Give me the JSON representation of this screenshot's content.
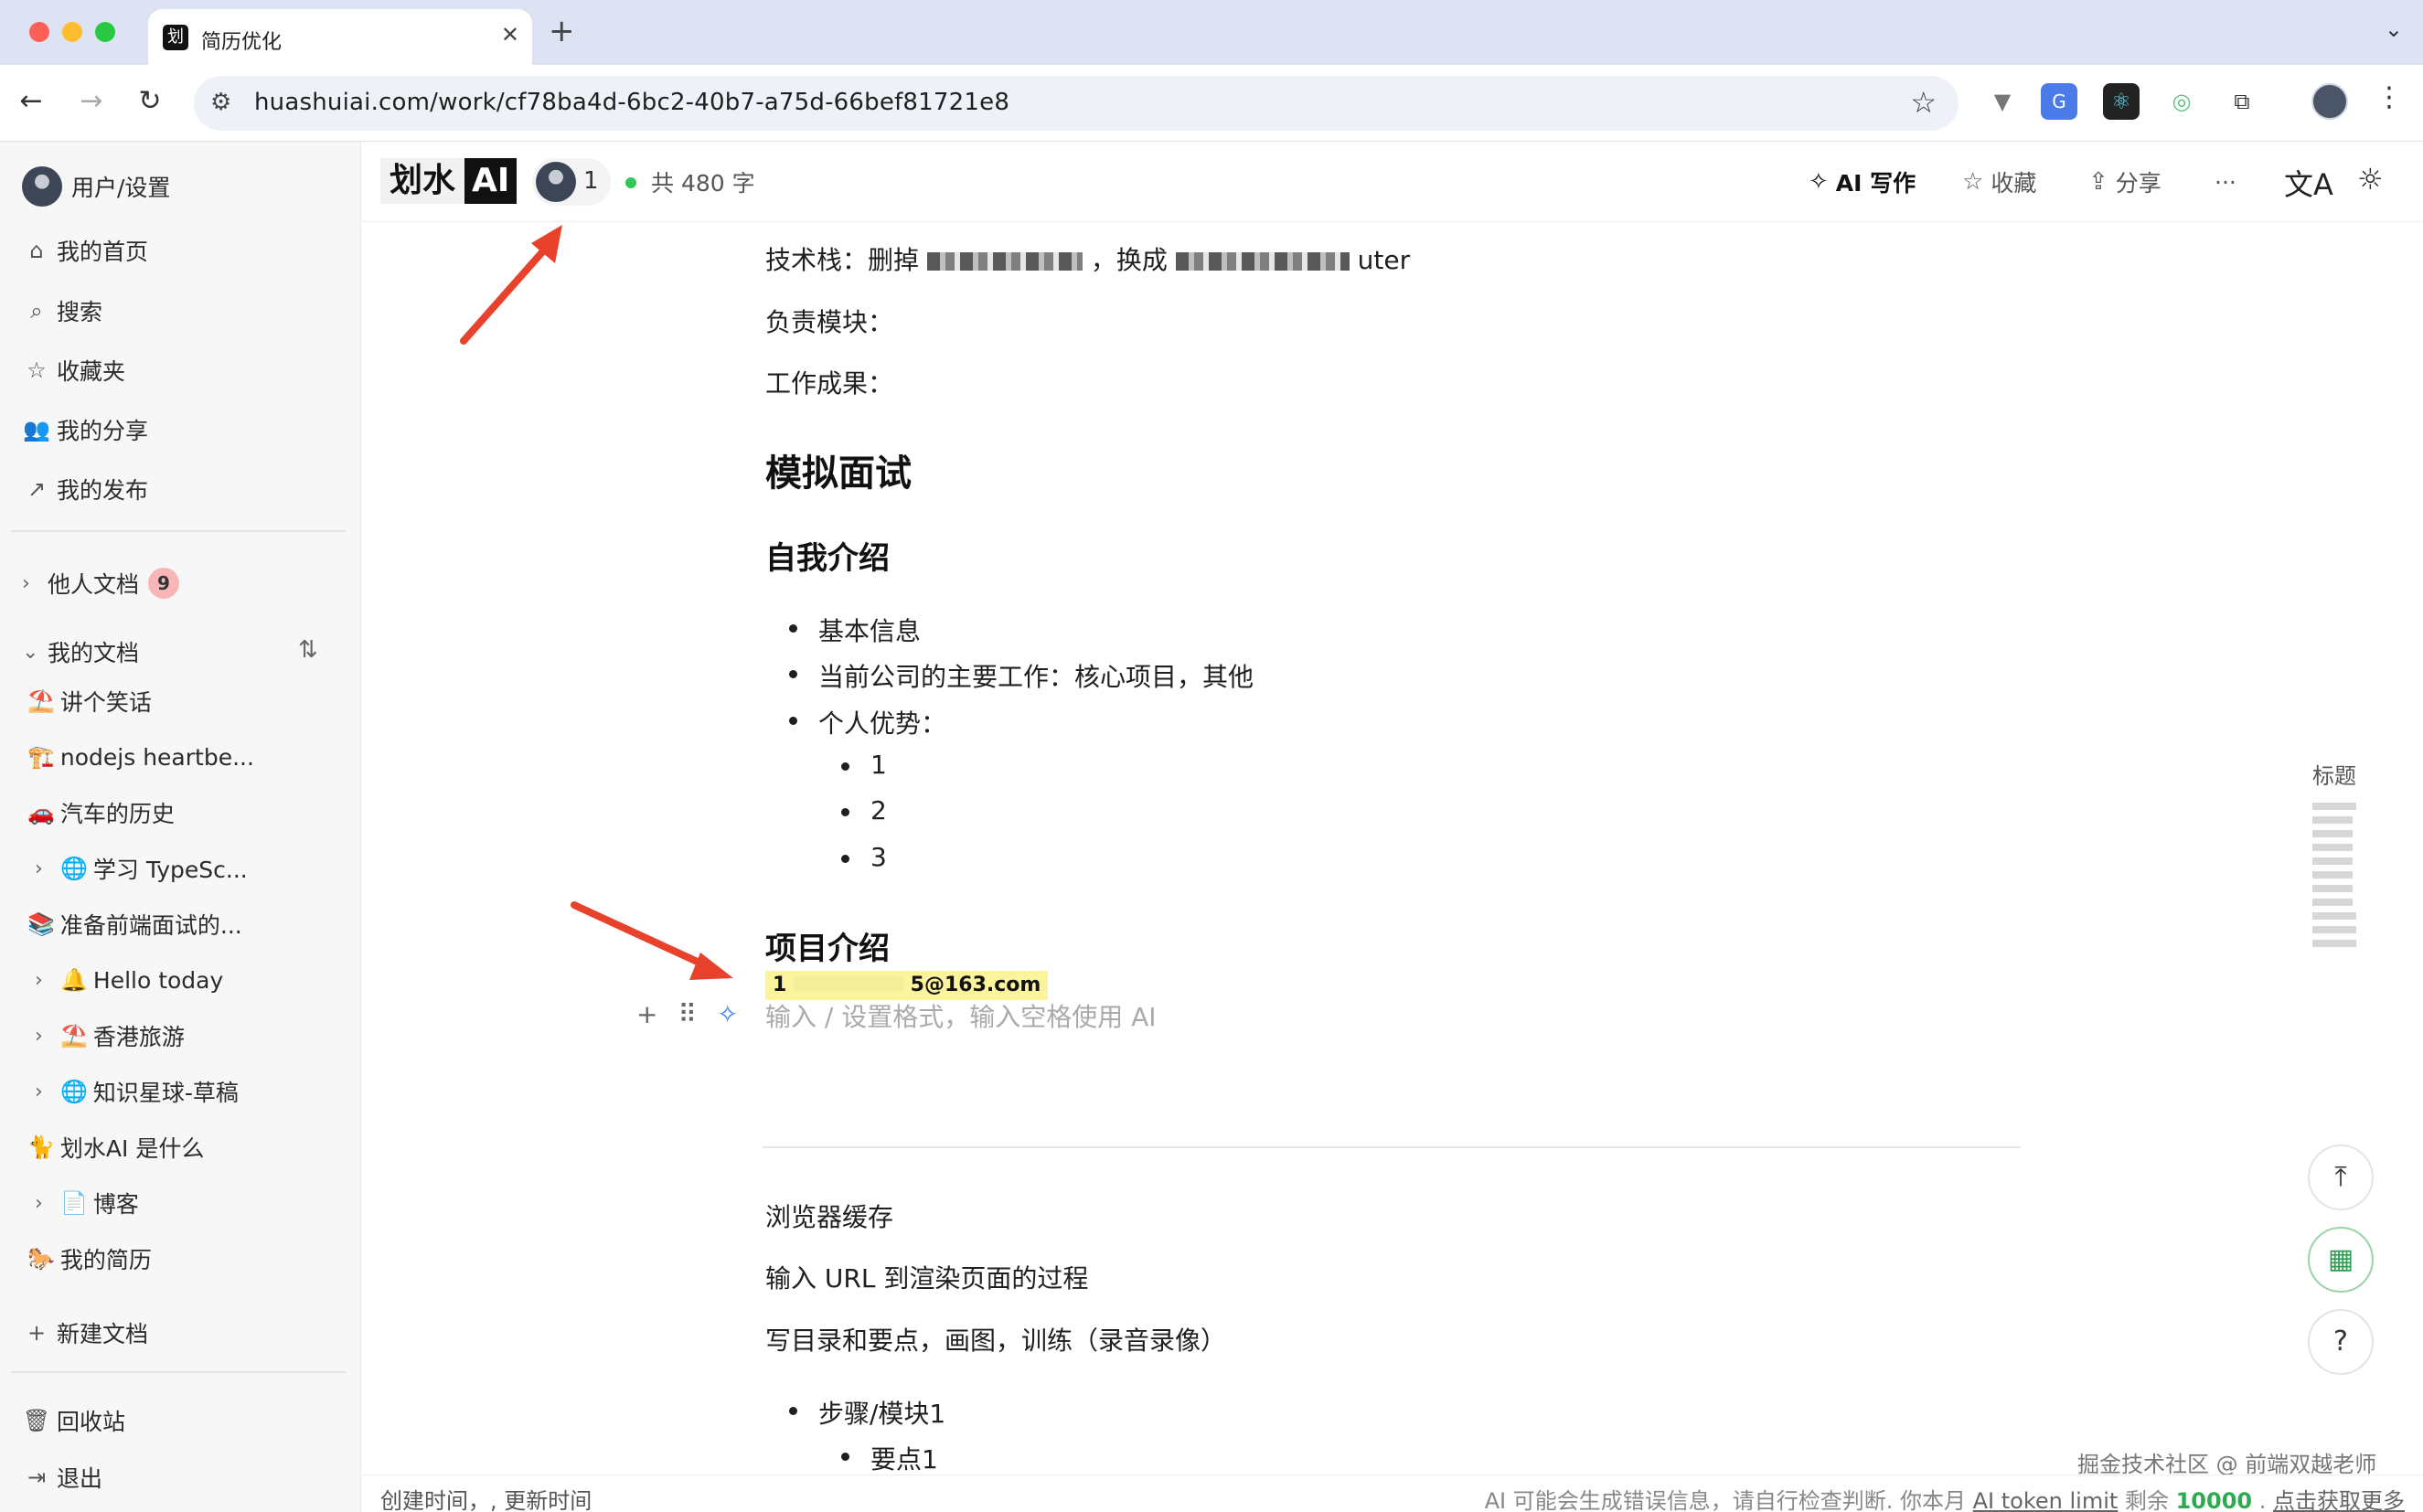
{
  "browser": {
    "tab_title": "简历优化",
    "tab_favicon": "划",
    "url": "huashuiai.com/work/cf78ba4d-6bc2-40b7-a75d-66bef81721e8"
  },
  "sidebar": {
    "user": "用户/设置",
    "nav": [
      {
        "icon": "home-icon",
        "label": "我的首页"
      },
      {
        "icon": "search-icon",
        "label": "搜索"
      },
      {
        "icon": "star-icon",
        "label": "收藏夹"
      },
      {
        "icon": "users-icon",
        "label": "我的分享"
      },
      {
        "icon": "external-link-icon",
        "label": "我的发布"
      }
    ],
    "others_docs": {
      "label": "他人文档",
      "count": "9"
    },
    "my_docs_label": "我的文档",
    "docs": [
      {
        "emoji": "⛱️",
        "label": "讲个笑话",
        "expandable": false
      },
      {
        "emoji": "🏗️",
        "label": "nodejs heartbe...",
        "expandable": false
      },
      {
        "emoji": "🚗",
        "label": "汽车的历史",
        "expandable": false
      },
      {
        "emoji": "🌐",
        "label": "学习 TypeSc...",
        "expandable": true
      },
      {
        "emoji": "📚",
        "label": "准备前端面试的...",
        "expandable": false
      },
      {
        "emoji": "🔔",
        "label": "Hello today",
        "expandable": true
      },
      {
        "emoji": "⛱️",
        "label": "香港旅游",
        "expandable": true
      },
      {
        "emoji": "🌐",
        "label": "知识星球-草稿",
        "expandable": true
      },
      {
        "emoji": "🐈",
        "label": "划水AI 是什么",
        "expandable": false
      },
      {
        "emoji": "📄",
        "label": "博客",
        "expandable": true
      },
      {
        "emoji": "🐎",
        "label": "我的简历",
        "expandable": false
      }
    ],
    "new_doc": "新建文档",
    "trash": "回收站",
    "logout": "退出"
  },
  "header": {
    "logo_text": "划水",
    "logo_ai": "AI",
    "collaborators": "1",
    "word_count": "共 480 字",
    "ai_write": "AI 写作",
    "favorite": "收藏",
    "share": "分享",
    "more": "···"
  },
  "editor": {
    "tech_stack_prefix": "技术栈：删掉",
    "tech_stack_mid": "，换成",
    "tech_stack_suffix": "uter",
    "module": "负责模块：",
    "results": "工作成果：",
    "h1_mock": "模拟面试",
    "h2_intro": "自我介绍",
    "intro_items": [
      "基本信息",
      "当前公司的主要工作：核心项目，其他",
      "个人优势："
    ],
    "sub_items": [
      "1",
      "2",
      "3"
    ],
    "h2_project": "项目介绍",
    "email_prefix": "1",
    "email_suffix": "5@163.com",
    "placeholder": "输入 / 设置格式，输入空格使用 AI",
    "after_hr": [
      "浏览器缓存",
      "输入 URL 到渲染页面的过程",
      "写目录和要点，画图，训练（录音录像）"
    ],
    "steps": "步骤/模块1",
    "point": "要点1"
  },
  "toc": {
    "title": "标题"
  },
  "status": {
    "left": "创建时间，, 更新时间",
    "right_prefix": "AI 可能会生成错误信息，请自行检查判断. 你本月",
    "token_link": "AI token limit",
    "remain": "剩余",
    "remain_value": "10000",
    "more_link": "点击获取更多"
  },
  "watermark": "掘金技术社区 @ 前端双越老师",
  "colors": {
    "accent_green": "#2eaa50",
    "highlight": "#fcf49c",
    "annotation_arrow": "#e8412c"
  }
}
